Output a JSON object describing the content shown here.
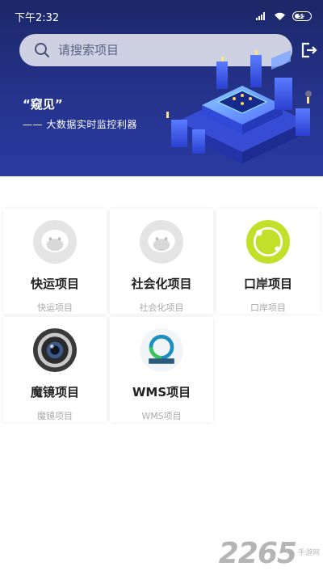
{
  "status_bar": {
    "time": "下午2:32",
    "battery_level": "59"
  },
  "search": {
    "placeholder": "请搜索项目"
  },
  "banner": {
    "title": "“窥见”",
    "subtitle": "—— 大数据实时监控利器"
  },
  "projects": [
    {
      "title": "快运项目",
      "subtitle": "快运项目",
      "icon": "default-avatar-icon"
    },
    {
      "title": "社会化项目",
      "subtitle": "社会化项目",
      "icon": "default-avatar-icon"
    },
    {
      "title": "口岸项目",
      "subtitle": "口岸项目",
      "icon": "lime-ring-icon"
    },
    {
      "title": "魔镜项目",
      "subtitle": "魔镜项目",
      "icon": "camera-lens-icon"
    },
    {
      "title": "WMS项目",
      "subtitle": "WMS项目",
      "icon": "wms-logo-icon"
    }
  ],
  "watermark": {
    "number": "2265",
    "site": "手游网"
  },
  "colors": {
    "header_top": "#1c2767",
    "header_bottom": "#2a3aa0",
    "accent_lime": "#c2e02a"
  }
}
